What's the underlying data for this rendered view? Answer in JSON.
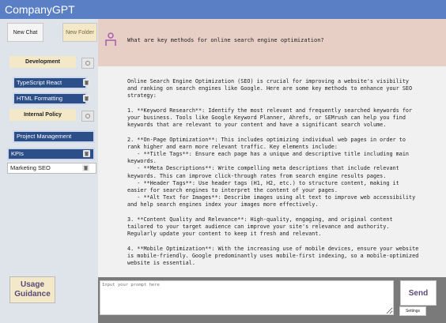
{
  "app": {
    "title": "CompanyGPT"
  },
  "sidebar": {
    "new_chat_label": "New Chat",
    "new_folder_label": "New Folder",
    "folders": [
      {
        "label": "Development",
        "chats": [
          "TypeScript React",
          "HTML Formatting"
        ]
      },
      {
        "label": "Internal Policy",
        "chats": [
          "Project Management"
        ]
      }
    ],
    "loose_chats": [
      "KPIs",
      "Marketing SEO"
    ],
    "usage_label": "Usage Guidance"
  },
  "conversation": {
    "question": "What are key methods for online search engine optimization?",
    "answer": "Online Search Engine Optimization (SEO) is crucial for improving a website's visibility\nand ranking on search engines like Google. Here are some key methods to enhance your SEO\nstrategy:\n\n1. **Keyword Research**: Identify the most relevant and frequently searched keywords for\nyour business. Tools like Google Keyword Planner, Ahrefs, or SEMrush can help you find\nkeywords that are relevant to your content and have a significant search volume.\n\n2. **On-Page Optimization**: This includes optimizing individual web pages in order to\nrank higher and earn more relevant traffic. Key elements include:\n   - **Title Tags**: Ensure each page has a unique and descriptive title including main\nkeywords.\n   - **Meta Descriptions**: Write compelling meta descriptions that include relevant\nkeywords. This can improve click-through rates from search engine results pages.\n   - **Header Tags**: Use header tags (H1, H2, etc.) to structure content, making it\neasier for search engines to interpret the content of your pages.\n   - **Alt Text for Images**: Describe images using alt text to improve web accessibility\nand help search engines index your images more effectively.\n\n3. **Content Quality and Relevance**: High-quality, engaging, and original content\ntailored to your target audience can improve your site's relevance and authority.\nRegularly update your content to keep it fresh and relevant.\n\n4. **Mobile Optimization**: With the increasing use of mobile devices, ensure your website\nis mobile-friendly. Google predominantly uses mobile-first indexing, so a mobile-optimized\nwebsite is essential."
  },
  "input": {
    "placeholder": "Input your prompt here",
    "send_label": "Send",
    "settings_label": "Settings"
  },
  "colors": {
    "titlebar": "#5b7fc4",
    "chat_selected": "#2d4f89",
    "folder": "#f3e8c8",
    "header": "#e8cfc6"
  }
}
